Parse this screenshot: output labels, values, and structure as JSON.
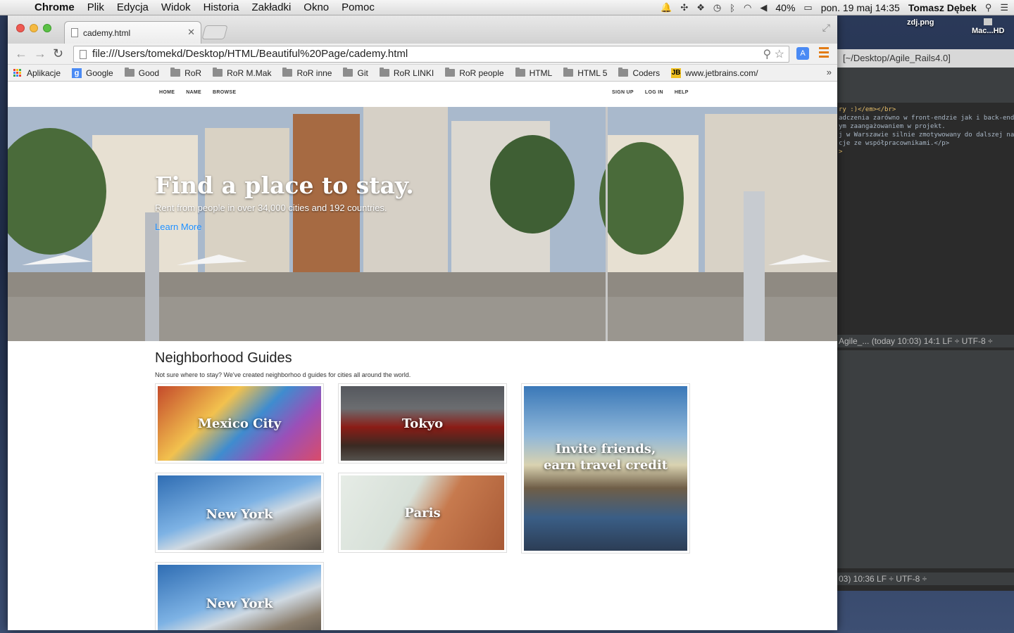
{
  "menubar": {
    "app": "Chrome",
    "items": [
      "Plik",
      "Edycja",
      "Widok",
      "Historia",
      "Zakładki",
      "Okno",
      "Pomoc"
    ],
    "battery": "40%",
    "datetime": "pon. 19 maj  14:35",
    "user": "Tomasz Dębek"
  },
  "desktop": {
    "icon1": "zdj.png",
    "icon2": "Mac...HD"
  },
  "ide": {
    "title": "[~/Desktop/Agile_Rails4.0]",
    "code_lines": [
      "ry :)</em></br>",
      "adczenia zarówno w front-endzie jak i back-endzie.",
      "ym zaangażowaniem w projekt.",
      "j w Warszawie silnie zmotywowany do dalszej nauki",
      "cje ze współpracownikami.</p>",
      "",
      "",
      ">"
    ],
    "status1": "Agile_... (today 10:03)    14:1    LF ÷   UTF-8 ÷",
    "status2": "03)    10:36    LF ÷   UTF-8 ÷"
  },
  "browser": {
    "tab_title": "cademy.html",
    "url": "file:///Users/tomekd/Desktop/HTML/Beautiful%20Page/cademy.html",
    "bookmarks": [
      "Aplikacje",
      "Google",
      "Good",
      "RoR",
      "RoR M.Mak",
      "RoR inne",
      "Git",
      "RoR LINKI",
      "RoR people",
      "HTML",
      "HTML 5",
      "Coders",
      "www.jetbrains.com/"
    ]
  },
  "site": {
    "nav_left": [
      "HOME",
      "NAME",
      "BROWSE"
    ],
    "nav_right": [
      "SIGN UP",
      "LOG IN",
      "HELP"
    ],
    "hero_title": "Find a place to stay.",
    "hero_sub": "Rent from people in over 34,000 cities and 192 countries.",
    "hero_link": "Learn More",
    "guides_title": "Neighborhood Guides",
    "guides_sub": "Not sure where to stay? We've created neighborhoo d guides for cities all around the world.",
    "cards": [
      "Mexico City",
      "Tokyo",
      "Invite friends, earn travel credit",
      "New York",
      "Paris",
      "New York"
    ],
    "invite_line1": "Invite friends,",
    "invite_line2": "earn travel credit"
  }
}
